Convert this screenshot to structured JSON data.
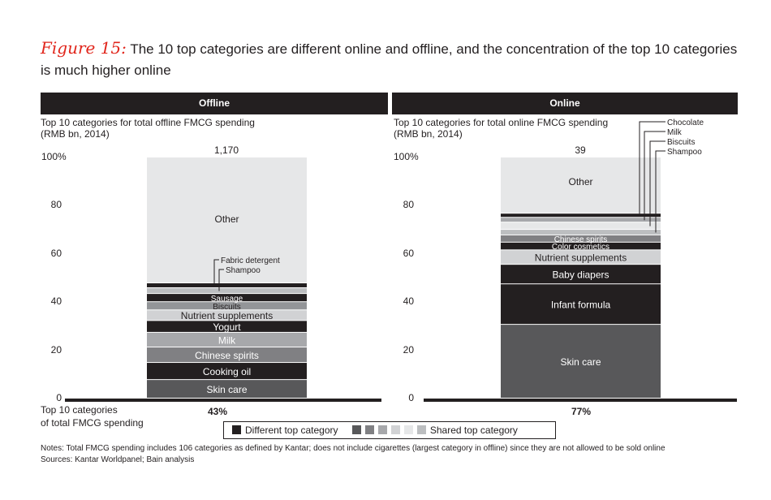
{
  "figure": {
    "label": "Figure 15:",
    "title": "The 10 top categories are different online and offline, and the concentration of the top 10 categories is much higher online"
  },
  "chart_data": [
    {
      "type": "bar",
      "stacked": true,
      "panel_title": "Offline",
      "subtitle_line1": "Top 10 categories for total offline FMCG spending",
      "subtitle_line2": "(RMB bn, 2014)",
      "total_label": "1,170",
      "top10_share_label": "43%",
      "ylim": [
        0,
        100
      ],
      "yticks": [
        "0",
        "20",
        "40",
        "60",
        "80",
        "100%"
      ],
      "segments": [
        {
          "name": "Skin care",
          "value": 7.7,
          "type": "shared",
          "color": "#58585a",
          "text_color": "#ffffff"
        },
        {
          "name": "Cooking oil",
          "value": 7.1,
          "type": "different",
          "color": "#231f20",
          "text_color": "#ffffff"
        },
        {
          "name": "Chinese spirits",
          "value": 6.4,
          "type": "shared",
          "color": "#808083",
          "text_color": "#ffffff"
        },
        {
          "name": "Milk",
          "value": 6.1,
          "type": "shared",
          "color": "#a7a8ab",
          "text_color": "#ffffff"
        },
        {
          "name": "Yogurt",
          "value": 4.9,
          "type": "different",
          "color": "#231f20",
          "text_color": "#ffffff"
        },
        {
          "name": "Nutrient supplements",
          "value": 4.4,
          "type": "shared",
          "color": "#d1d2d4",
          "text_color": "#231f20"
        },
        {
          "name": "Biscuits",
          "value": 3.4,
          "type": "shared",
          "color": "#939598",
          "text_color": "#231f20"
        },
        {
          "name": "Sausage",
          "value": 3.4,
          "type": "different",
          "color": "#231f20",
          "text_color": "#ffffff"
        },
        {
          "name": "Shampoo",
          "value": 2.4,
          "type": "shared",
          "color": "#bcbec0",
          "text_color": "#231f20",
          "callout": true
        },
        {
          "name": "Fabric detergent",
          "value": 2.0,
          "type": "different",
          "color": "#231f20",
          "text_color": "#ffffff",
          "callout": true
        },
        {
          "name": "Other",
          "value": 52.2,
          "type": "other",
          "color": "#e6e7e8",
          "text_color": "#231f20"
        }
      ]
    },
    {
      "type": "bar",
      "stacked": true,
      "panel_title": "Online",
      "subtitle_line1": "Top 10 categories for total online FMCG spending",
      "subtitle_line2": "(RMB bn, 2014)",
      "total_label": "39",
      "top10_share_label": "77%",
      "ylim": [
        0,
        100
      ],
      "yticks": [
        "0",
        "20",
        "40",
        "60",
        "80",
        "100%"
      ],
      "segments": [
        {
          "name": "Skin care",
          "value": 30.6,
          "type": "shared",
          "color": "#58585a",
          "text_color": "#ffffff"
        },
        {
          "name": "Infant formula",
          "value": 16.8,
          "type": "different",
          "color": "#231f20",
          "text_color": "#ffffff"
        },
        {
          "name": "Baby diapers",
          "value": 8.1,
          "type": "different",
          "color": "#231f20",
          "text_color": "#ffffff"
        },
        {
          "name": "Nutrient supplements",
          "value": 6.0,
          "type": "shared",
          "color": "#d1d2d4",
          "text_color": "#231f20"
        },
        {
          "name": "Color cosmetics",
          "value": 3.2,
          "type": "different",
          "color": "#231f20",
          "text_color": "#ffffff"
        },
        {
          "name": "Chinese spirits",
          "value": 3.0,
          "type": "shared",
          "color": "#808083",
          "text_color": "#ffffff"
        },
        {
          "name": "Shampoo",
          "value": 2.3,
          "type": "shared",
          "color": "#bcbec0",
          "text_color": "#231f20",
          "callout": true
        },
        {
          "name": "Biscuits",
          "value": 3.0,
          "type": "shared",
          "color": "#e6e7e8",
          "text_color": "#231f20",
          "callout": true
        },
        {
          "name": "Milk",
          "value": 2.0,
          "type": "shared",
          "color": "#a7a8ab",
          "text_color": "#231f20",
          "callout": true
        },
        {
          "name": "Chocolate",
          "value": 1.7,
          "type": "different",
          "color": "#231f20",
          "text_color": "#ffffff",
          "callout": true
        },
        {
          "name": "Other",
          "value": 23.3,
          "type": "other",
          "color": "#e6e7e8",
          "text_color": "#231f20"
        }
      ]
    }
  ],
  "bottom_label_line1": "Top 10 categories",
  "bottom_label_line2": "of total FMCG spending",
  "legend": {
    "different_label": "Different top category",
    "shared_label": "Shared top category",
    "different_color": "#231f20",
    "shared_colors": [
      "#58585a",
      "#808083",
      "#a7a8ab",
      "#d1d2d4",
      "#e6e7e8",
      "#bcbec0"
    ]
  },
  "notes": "Notes: Total FMCG spending includes 106 categories as defined by Kantar; does not include cigarettes (largest category in offline) since they are not allowed to be sold online",
  "sources": "Sources: Kantar Worldpanel; Bain analysis"
}
